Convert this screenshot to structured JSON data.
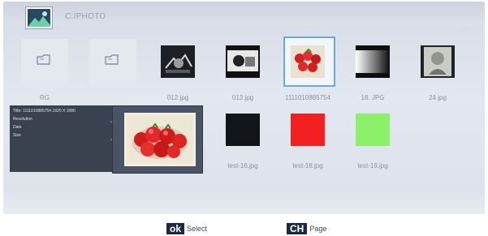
{
  "header": {
    "path": "C:/PHOTO"
  },
  "grid": {
    "row1": [
      {
        "type": "folder",
        "caption": "RG",
        "icon": "folder-icon"
      },
      {
        "type": "folder",
        "caption": "",
        "icon": "folder-icon"
      },
      {
        "type": "photo",
        "caption": "012.jpg",
        "icon": "photo-thumbnail"
      },
      {
        "type": "photo",
        "caption": "013.jpg",
        "icon": "photo-thumbnail"
      },
      {
        "type": "photo",
        "caption": "1111010885754",
        "icon": "photo-thumbnail",
        "selected": true
      },
      {
        "type": "photo",
        "caption": "18. JPG",
        "icon": "photo-thumbnail"
      },
      {
        "type": "photo",
        "caption": "24.jpg",
        "icon": "photo-thumbnail"
      }
    ],
    "row2": [
      {
        "type": "photo",
        "caption": "test-16.jpg",
        "color": "#111418"
      },
      {
        "type": "photo",
        "caption": "test-18.jpg",
        "color": "#f22020"
      },
      {
        "type": "photo",
        "caption": "test-19.jpg",
        "color": "#8cf06a"
      }
    ]
  },
  "info_panel": {
    "rows": [
      "Title: 1111010885754 1920 X 1080",
      "Resolution",
      "Date",
      "Size"
    ]
  },
  "footer": {
    "ok_key": "ok",
    "ok_label": "Select",
    "ch_key": "CH",
    "ch_label": "Page"
  },
  "colors": {
    "selection": "#6aa9dc",
    "key_bg": "#1b2a3f"
  }
}
